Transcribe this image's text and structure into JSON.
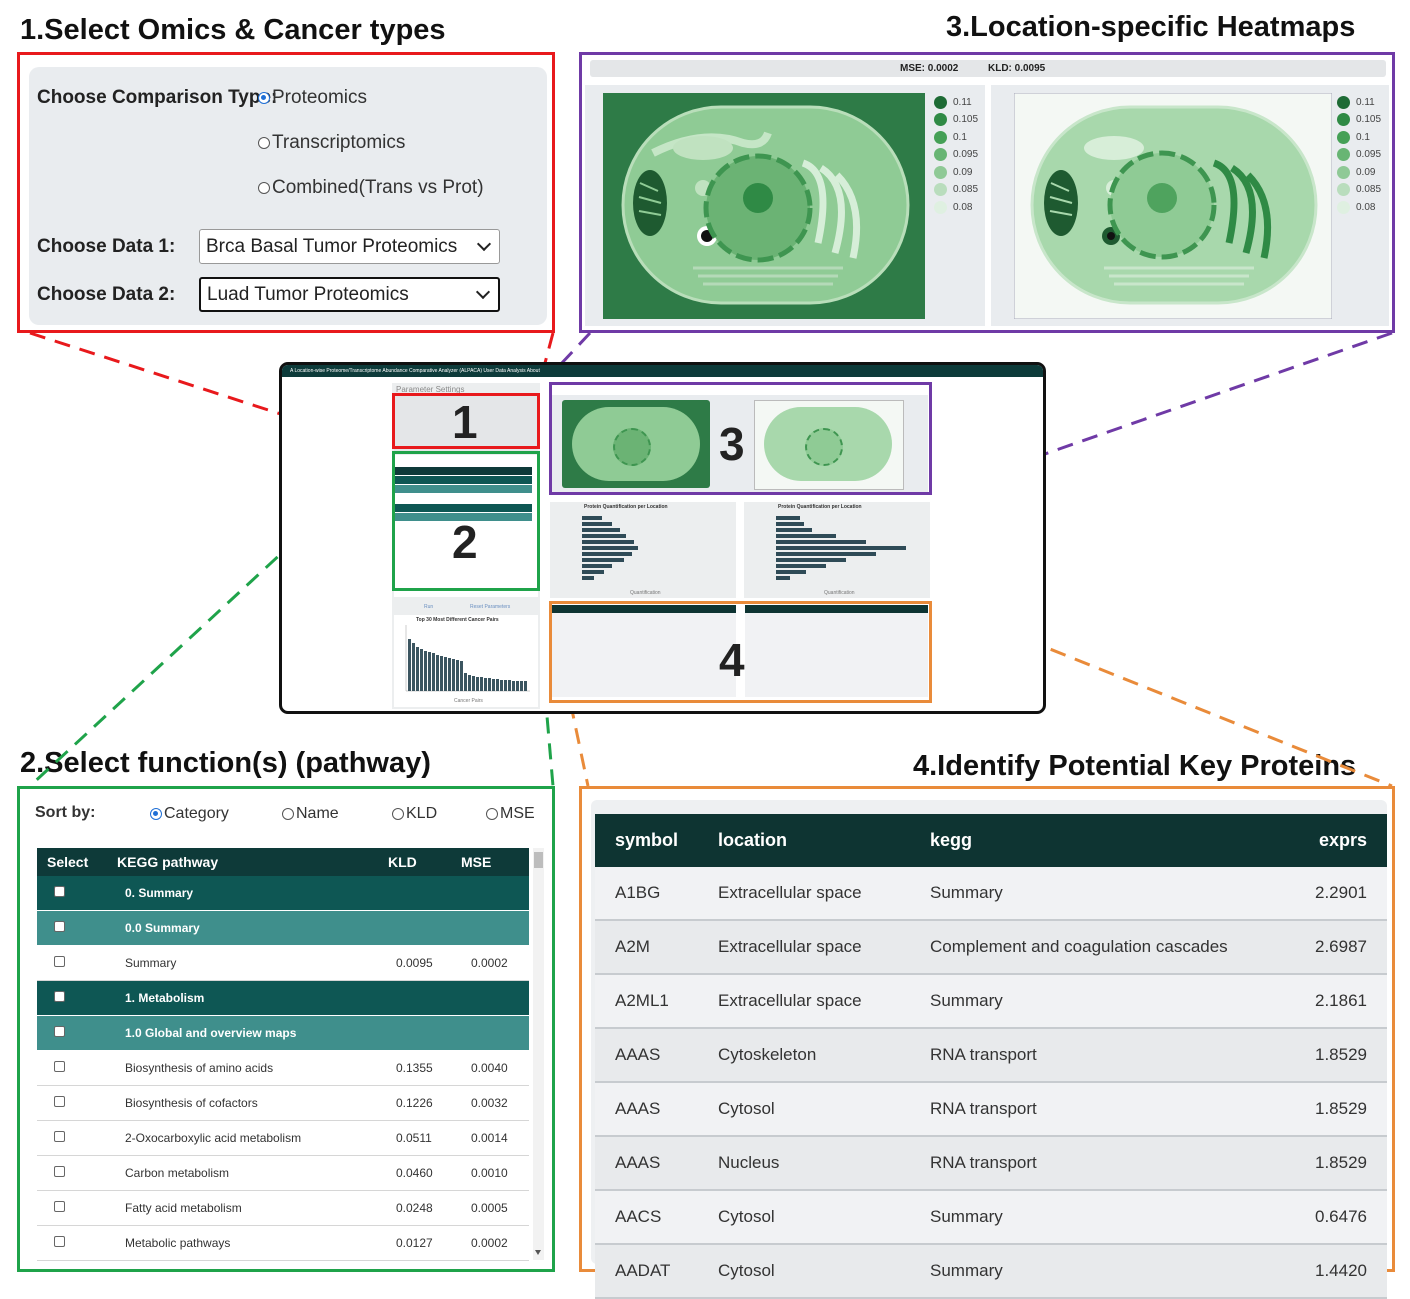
{
  "titles": {
    "s1": "1.Select Omics & Cancer types",
    "s2": "2.Select function(s) (pathway)",
    "s3": "3.Location-specific Heatmaps",
    "s4": "4.Identify Potential Key Proteins"
  },
  "panel1": {
    "comparison_label": "Choose Comparison Type:",
    "options": [
      "Proteomics",
      "Transcriptomics",
      "Combined(Trans vs Prot)"
    ],
    "selected_option": "Proteomics",
    "data1_label": "Choose Data 1:",
    "data1_value": "Brca Basal Tumor Proteomics",
    "data2_label": "Choose Data 2:",
    "data2_value": "Luad Tumor Proteomics"
  },
  "panel3": {
    "mse_text": "MSE: 0.0002",
    "kld_text": "KLD: 0.0095",
    "legend": [
      "0.11",
      "0.105",
      "0.1",
      "0.095",
      "0.09",
      "0.085",
      "0.08"
    ],
    "legend_colors": [
      "#1e6b35",
      "#2f8a45",
      "#45a056",
      "#68b574",
      "#8fc996",
      "#b9ddbd",
      "#dff0e1"
    ]
  },
  "mini": {
    "nav_text": "A Location-wise Proteome/Transcriptome Abundance Comparative Analyzer (ALPACA)   User Data Analysis   About",
    "settings_title": "Parameter Settings",
    "chart_title": "Protein Quantification per Location",
    "chart_xlabel": "Quantification",
    "bottom_chart_title": "Top 30 Most Different Cancer Pairs",
    "bottom_chart_xlabel": "Cancer Pairs",
    "run_label": "Run",
    "reset_label": "Reset Parameters",
    "badges": [
      "1",
      "2",
      "3",
      "4"
    ]
  },
  "panel2": {
    "sort_label": "Sort by:",
    "sort_options": [
      "Category",
      "Name",
      "KLD",
      "MSE"
    ],
    "sort_selected": "Category",
    "columns": [
      "Select",
      "KEGG pathway",
      "KLD",
      "MSE"
    ],
    "rows": [
      {
        "type": "hdr1",
        "name": "0. Summary",
        "kld": "",
        "mse": ""
      },
      {
        "type": "hdr2",
        "name": "0.0 Summary",
        "kld": "",
        "mse": ""
      },
      {
        "type": "row",
        "name": "Summary",
        "kld": "0.0095",
        "mse": "0.0002"
      },
      {
        "type": "hdr1",
        "name": "1. Metabolism",
        "kld": "",
        "mse": ""
      },
      {
        "type": "hdr2",
        "name": "1.0 Global and overview maps",
        "kld": "",
        "mse": ""
      },
      {
        "type": "row",
        "name": "Biosynthesis of amino acids",
        "kld": "0.1355",
        "mse": "0.0040"
      },
      {
        "type": "row",
        "name": "Biosynthesis of cofactors",
        "kld": "0.1226",
        "mse": "0.0032"
      },
      {
        "type": "row",
        "name": "2-Oxocarboxylic acid metabolism",
        "kld": "0.0511",
        "mse": "0.0014"
      },
      {
        "type": "row",
        "name": "Carbon metabolism",
        "kld": "0.0460",
        "mse": "0.0010"
      },
      {
        "type": "row",
        "name": "Fatty acid metabolism",
        "kld": "0.0248",
        "mse": "0.0005"
      },
      {
        "type": "row",
        "name": "Metabolic pathways",
        "kld": "0.0127",
        "mse": "0.0002"
      }
    ]
  },
  "panel4": {
    "columns": [
      "symbol",
      "location",
      "kegg",
      "exprs"
    ],
    "rows": [
      [
        "A1BG",
        "Extracellular space",
        "Summary",
        "2.2901"
      ],
      [
        "A2M",
        "Extracellular space",
        "Complement and coagulation cascades",
        "2.6987"
      ],
      [
        "A2ML1",
        "Extracellular space",
        "Summary",
        "2.1861"
      ],
      [
        "AAAS",
        "Cytoskeleton",
        "RNA transport",
        "1.8529"
      ],
      [
        "AAAS",
        "Cytosol",
        "RNA transport",
        "1.8529"
      ],
      [
        "AAAS",
        "Nucleus",
        "RNA transport",
        "1.8529"
      ],
      [
        "AACS",
        "Cytosol",
        "Summary",
        "0.6476"
      ],
      [
        "AADAT",
        "Cytosol",
        "Summary",
        "1.4420"
      ]
    ]
  }
}
